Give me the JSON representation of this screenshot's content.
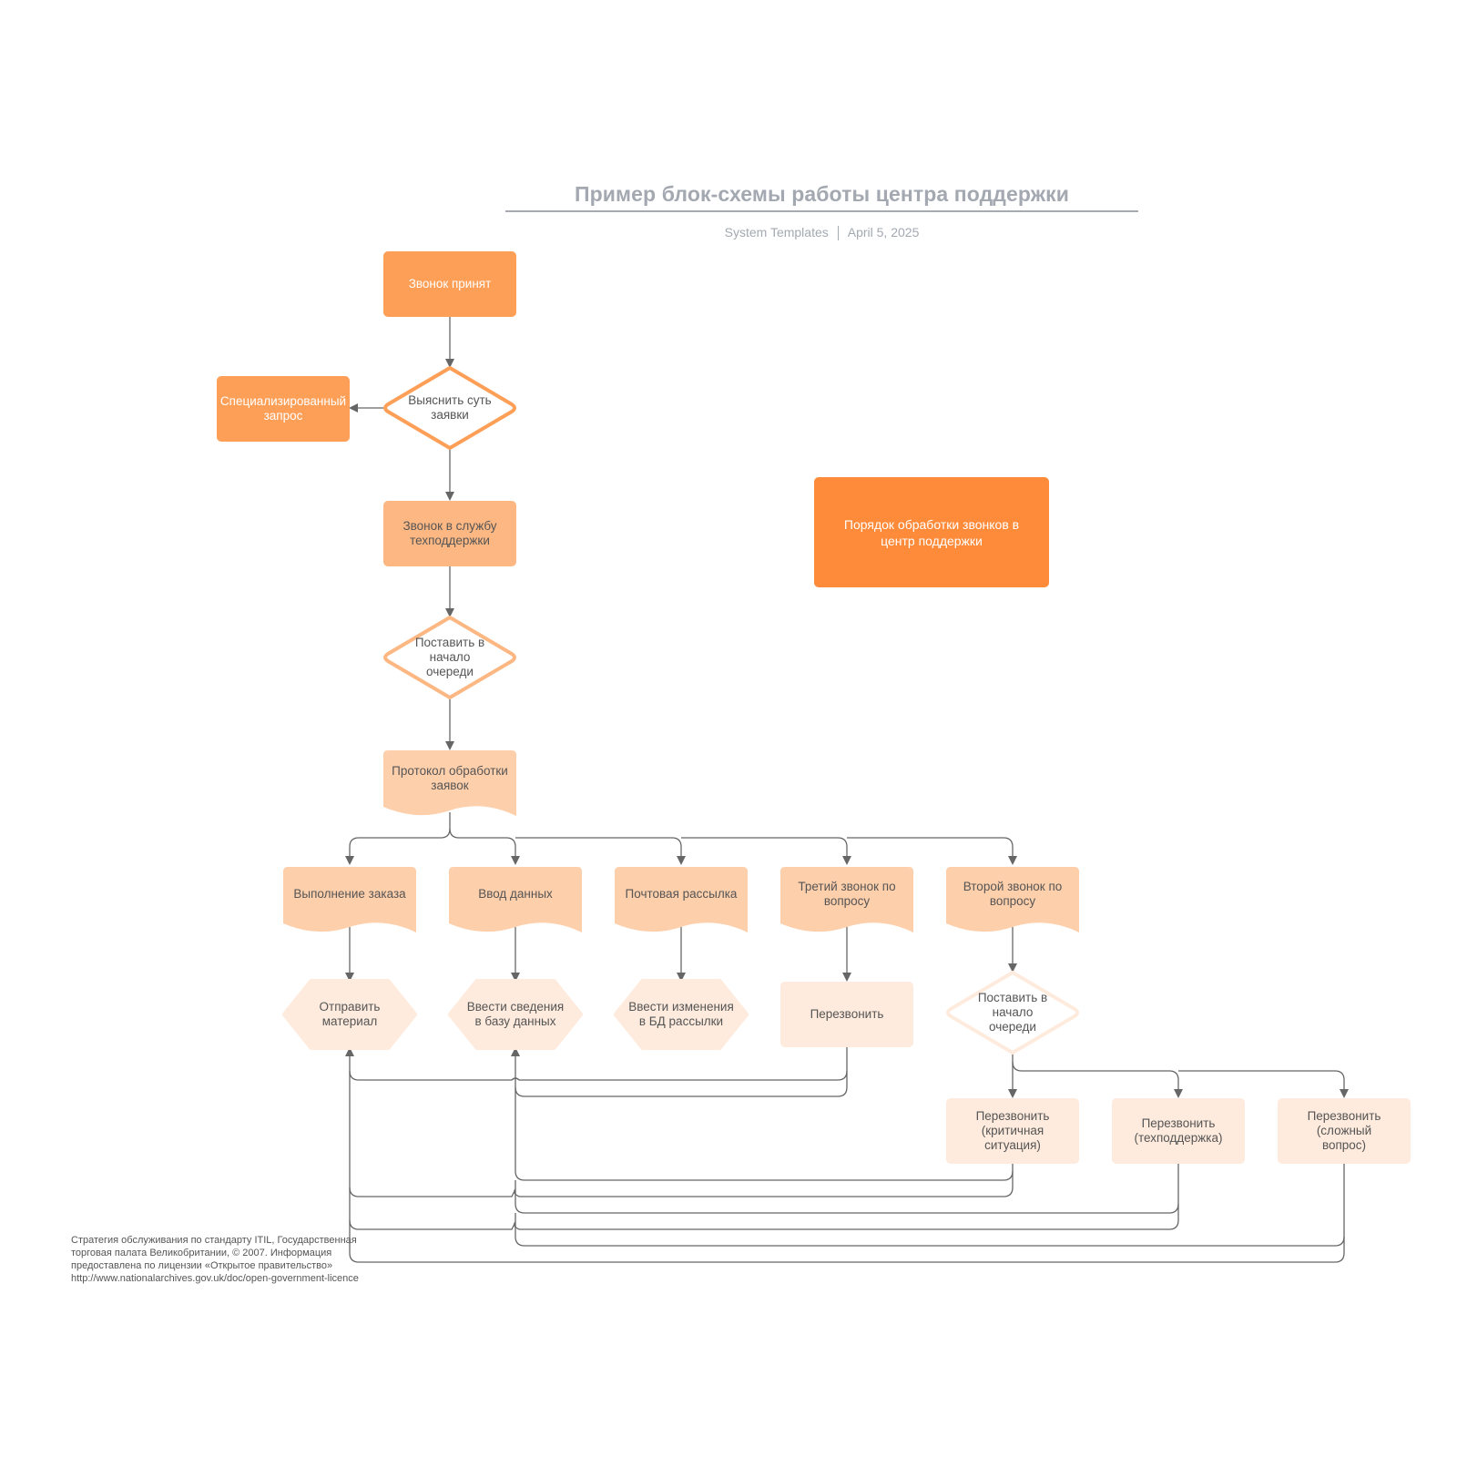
{
  "header": {
    "title": "Пример блок-схемы работы центра поддержки",
    "author": "System Templates",
    "date": "April 5, 2025"
  },
  "colors": {
    "primary_orange": "#fe9f57",
    "medium_orange": "#fcb783",
    "light_orange": "#fecfab",
    "pale_orange": "#feebdd",
    "title_box_orange": "#fe8b3a",
    "connector": "#666666",
    "title_gray": "#a3a8b1"
  },
  "nodes": {
    "call_received": "Звонок принят",
    "clarify_request": "Выяснить суть заявки",
    "specialized_request": "Специализированный запрос",
    "support_call": "Звонок в службу техподдержки",
    "queue_front_1": "Поставить в начало очереди",
    "request_protocol": "Протокол обработки заявок",
    "order_fulfillment": "Выполнение заказа",
    "data_entry": "Ввод данных",
    "mailing": "Почтовая рассылка",
    "third_call": "Третий звонок по вопросу",
    "second_call": "Второй звонок по вопросу",
    "send_material": "Отправить материал",
    "enter_db_info": "Ввести сведения в базу данных",
    "enter_mailing_db_changes": "Ввести изменения в БД рассылки",
    "call_back": "Перезвонить",
    "queue_front_2": "Поставить в начало очереди",
    "call_back_critical": "Перезвонить (критичная ситуация)",
    "call_back_support": "Перезвонить (техподдержка)",
    "call_back_complex": "Перезвонить (сложный вопрос)"
  },
  "info_box": "Порядок обработки звонков в центр поддержки",
  "footnote": "Стратегия обслуживания по стандарту ITIL, Государственная торговая палата Великобритании, © 2007. Информация предоставлена по лицензии «Открытое правительство» http://www.nationalarchives.gov.uk/doc/open-government-licence"
}
